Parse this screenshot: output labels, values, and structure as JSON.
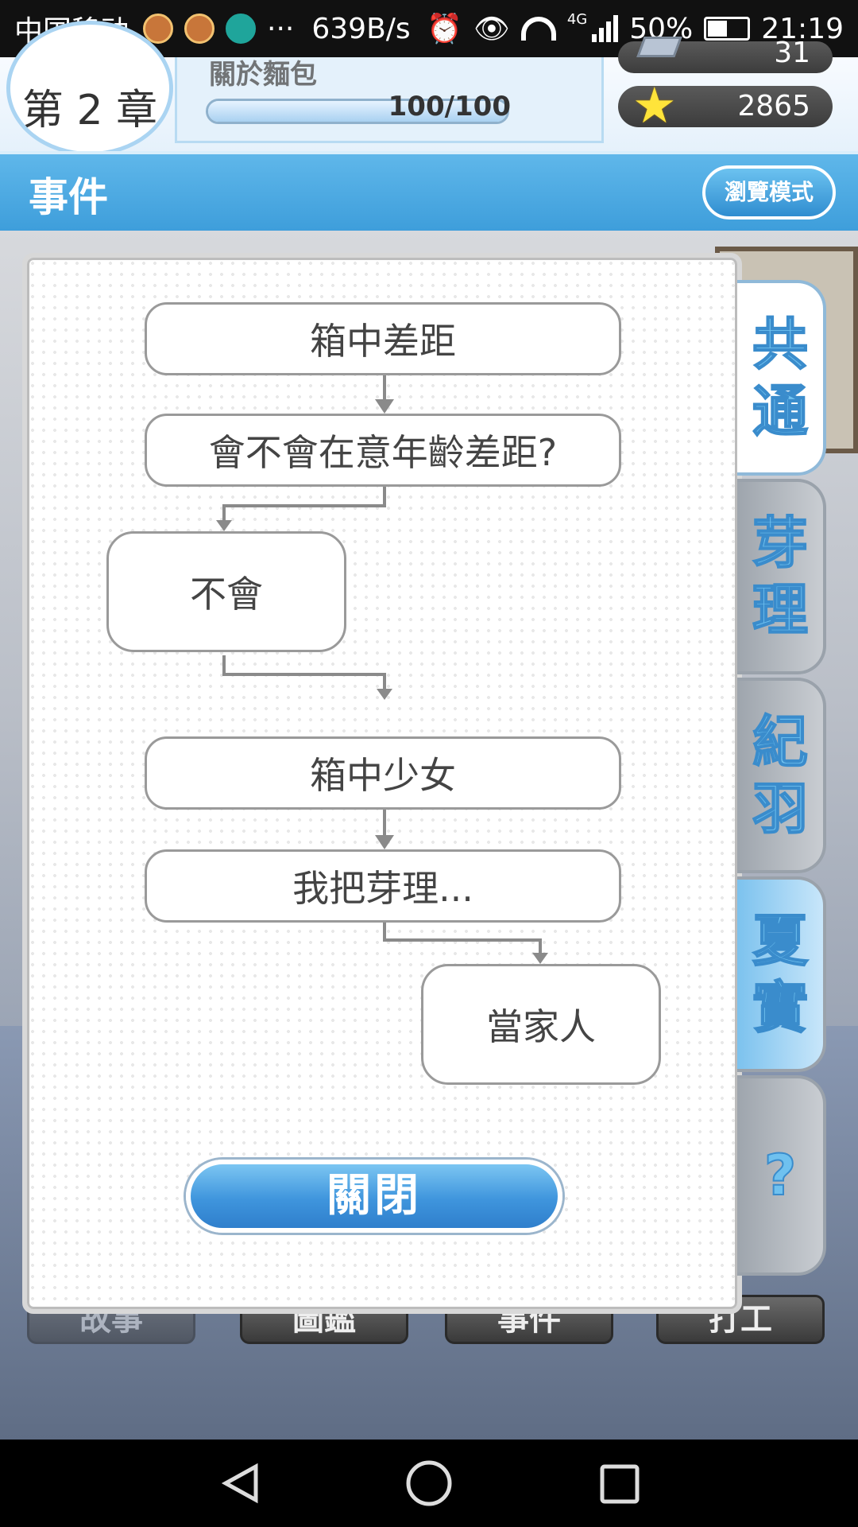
{
  "status_bar": {
    "carrier": "中国移动",
    "dots": "···",
    "speed": "639B/s",
    "network": "4G",
    "battery": "50%",
    "time": "21:19"
  },
  "header": {
    "chapter": "第 2 章",
    "subtitle": "關於麵包",
    "progress": {
      "current": 100,
      "max": 100,
      "label": "100/100"
    },
    "gems": "31",
    "stars": "2865"
  },
  "section": {
    "title": "事件",
    "browse_label": "瀏覽模式"
  },
  "flow": {
    "event1_title": "箱中差距",
    "event1_question": "會不會在意年齡差距?",
    "event1_answer": "不會",
    "event2_title": "箱中少女",
    "event2_question": "我把芽理...",
    "event2_answer": "當家人"
  },
  "close_label": "關閉",
  "tabs": [
    {
      "line1": "共",
      "line2": "通",
      "state": "active"
    },
    {
      "line1": "芽",
      "line2": "理",
      "state": "normal"
    },
    {
      "line1": "紀",
      "line2": "羽",
      "state": "normal"
    },
    {
      "line1": "夏",
      "line2": "實",
      "state": "highlight"
    },
    {
      "line1": "?",
      "line2": "",
      "state": "normal"
    }
  ],
  "bottom_nav": [
    "故事",
    "圖鑑",
    "事件",
    "打工"
  ],
  "colors": {
    "accent": "#3e9edb",
    "tab_text": "#6fc1ef"
  }
}
